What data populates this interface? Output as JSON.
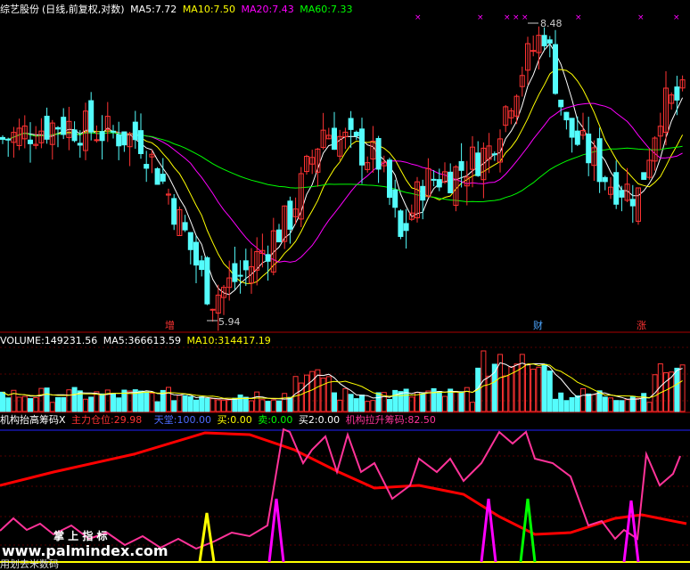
{
  "header": {
    "name": "综艺股份",
    "mode": "(日线,前复权,对数)",
    "ma5_label": "MA5:",
    "ma5": "7.72",
    "ma10_label": "MA10:",
    "ma10": "7.50",
    "ma20_label": "MA20:",
    "ma20": "7.43",
    "ma60_label": "MA60:",
    "ma60": "7.33"
  },
  "price_panel": {
    "high_label": "8.48",
    "low_label": "5.94",
    "markers": [
      "增",
      "财",
      "涨"
    ]
  },
  "volume_panel": {
    "volume_label": "VOLUME:",
    "volume": "149231.56",
    "ma5_label": "MA5:",
    "ma5": "366613.59",
    "ma10_label": "MA10:",
    "ma10": "314417.19"
  },
  "indicator_panel": {
    "title": "机构抬高筹码X",
    "main_label": "主力仓位:",
    "main": "29.98",
    "top_label": "天堂:",
    "top": "100.00",
    "buy_label": "买:",
    "buy": "0.00",
    "sell_label": "卖:",
    "sell": "0.00",
    "buy2_label": "买2:",
    "buy2": "0.00",
    "pull_label": "机构拉升筹码:",
    "pull": "82.50"
  },
  "watermark": {
    "brand": "掌 上 指 标",
    "url": "www.palmindex.com",
    "footer": "用划去米数码"
  },
  "colors": {
    "ma5": "#ffffff",
    "ma10": "#ffff00",
    "ma20": "#ff00ff",
    "ma60": "#00ff00",
    "up": "#ff3333",
    "down": "#54fcfc",
    "main_line": "#ff0000",
    "pull_line": "#ff3399",
    "top_line": "#2020ff"
  },
  "chart_data": {
    "type": "candlestick",
    "high": 8.48,
    "low": 5.94,
    "volume_ylim": [
      0,
      1
    ]
  }
}
